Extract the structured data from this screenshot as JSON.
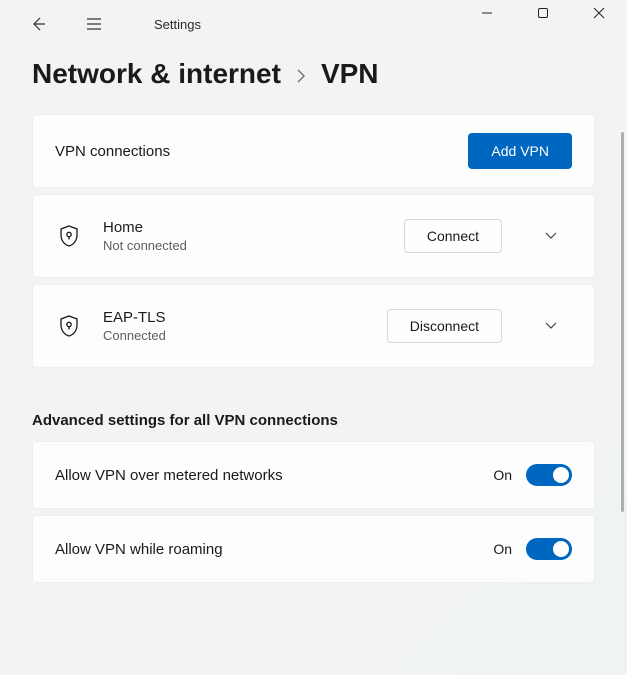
{
  "window": {
    "app_title": "Settings"
  },
  "breadcrumb": {
    "parent": "Network & internet",
    "current": "VPN"
  },
  "vpn_section": {
    "header_label": "VPN connections",
    "add_button": "Add VPN",
    "entries": [
      {
        "name": "Home",
        "status": "Not connected",
        "action": "Connect"
      },
      {
        "name": "EAP-TLS",
        "status": "Connected",
        "action": "Disconnect"
      }
    ]
  },
  "advanced": {
    "heading": "Advanced settings for all VPN connections",
    "items": [
      {
        "label": "Allow VPN over metered networks",
        "state": "On"
      },
      {
        "label": "Allow VPN while roaming",
        "state": "On"
      }
    ]
  }
}
